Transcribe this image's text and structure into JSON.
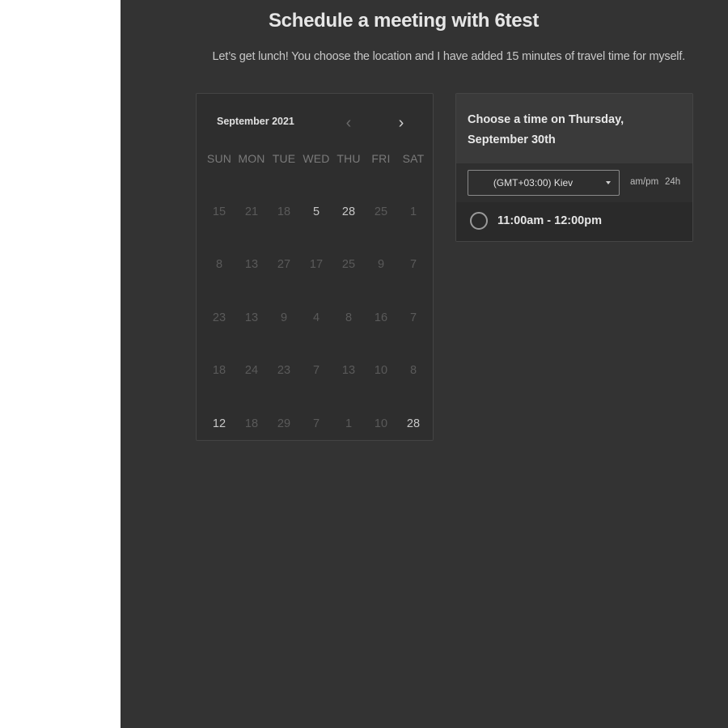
{
  "page": {
    "title": "Schedule a meeting with 6test",
    "subtitle": "Let’s get lunch! You choose the location and I have added 15 minutes of travel time for myself."
  },
  "calendar": {
    "month_label": "September 2021",
    "prev_icon": "chevron-left-icon",
    "next_icon": "chevron-right-icon",
    "weekdays": [
      "SUN",
      "MON",
      "TUE",
      "WED",
      "THU",
      "FRI",
      "SAT"
    ],
    "weeks": [
      [
        "15",
        "21",
        "18",
        "5",
        "28",
        "25",
        "1"
      ],
      [
        "8",
        "13",
        "27",
        "17",
        "25",
        "9",
        "7"
      ],
      [
        "23",
        "13",
        "9",
        "4",
        "8",
        "16",
        "7"
      ],
      [
        "18",
        "24",
        "23",
        "7",
        "13",
        "10",
        "8"
      ],
      [
        "12",
        "18",
        "29",
        "7",
        "1",
        "10",
        "28"
      ]
    ],
    "active_cells": [
      [
        0,
        3
      ],
      [
        0,
        4
      ],
      [
        4,
        0
      ],
      [
        4,
        6
      ]
    ]
  },
  "time_panel": {
    "title": "Choose a time on Thursday, September 30th",
    "timezone": "(GMT+03:00) Kiev",
    "format_ampm": "am/pm",
    "format_24h": "24h",
    "slots": [
      "11:00am - 12:00pm"
    ]
  },
  "colors": {
    "panel_bg": "#333333",
    "calendar_bg": "#2e2e2e",
    "text_primary": "#e6e6e6",
    "text_muted": "#5a5a5a"
  }
}
